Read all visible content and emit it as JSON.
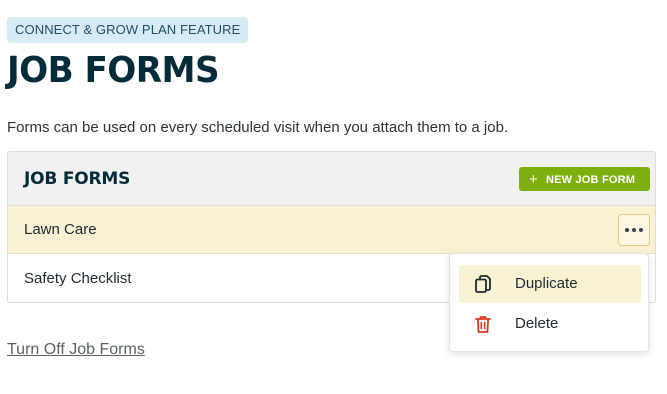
{
  "badge": {
    "label": "CONNECT & GROW PLAN FEATURE"
  },
  "header": {
    "title": "JOB FORMS",
    "description": "Forms can be used on every scheduled visit when you attach them to a job."
  },
  "card": {
    "title": "JOB FORMS",
    "new_button": {
      "icon": "+",
      "label": "NEW JOB FORM"
    },
    "rows": [
      {
        "label": "Lawn Care",
        "highlighted": true
      },
      {
        "label": "Safety Checklist",
        "highlighted": false
      }
    ]
  },
  "menu": {
    "items": [
      {
        "label": "Duplicate",
        "icon": "copy-icon"
      },
      {
        "label": "Delete",
        "icon": "trash-icon"
      }
    ]
  },
  "footer": {
    "turn_off_link": "Turn Off Job Forms"
  },
  "colors": {
    "accent_green": "#7db00e",
    "highlight": "#f8f2d2",
    "badge_bg": "#d6ebf6",
    "heading": "#032b3a",
    "delete_red": "#d9391f"
  }
}
